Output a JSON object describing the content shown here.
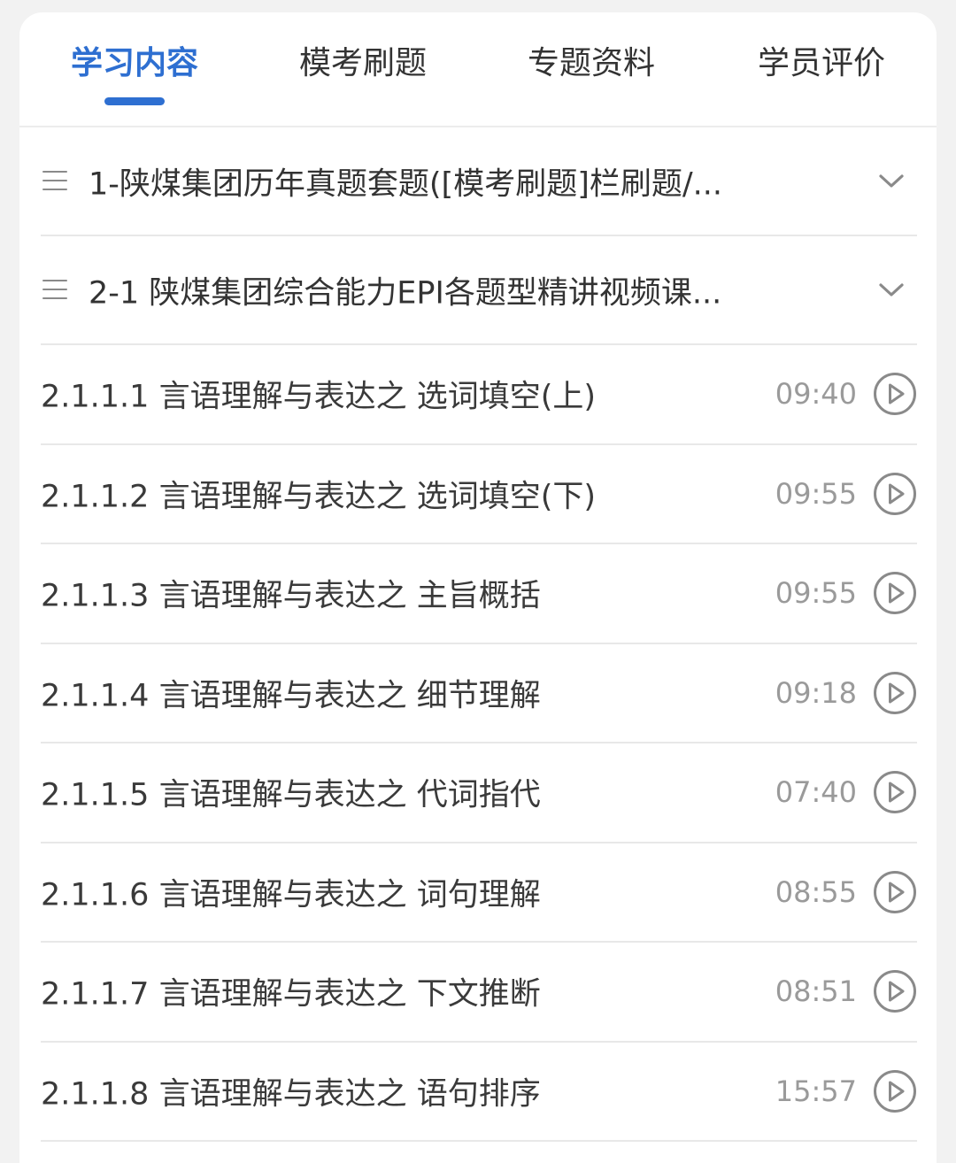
{
  "tabs": [
    {
      "label": "学习内容",
      "active": true
    },
    {
      "label": "模考刷题",
      "active": false
    },
    {
      "label": "专题资料",
      "active": false
    },
    {
      "label": "学员评价",
      "active": false
    }
  ],
  "colors": {
    "accent": "#2e6fd1",
    "text": "#333333",
    "muted": "#9a9a9a",
    "divider": "#e8e8e8"
  },
  "chapters": [
    {
      "title": "1-陕煤集团历年真题套题([模考刷题]栏刷题/...",
      "icon": "menu-icon",
      "toggle_icon": "chevron-down-icon"
    },
    {
      "title": "2-1 陕煤集团综合能力EPI各题型精讲视频课...",
      "icon": "menu-icon",
      "toggle_icon": "chevron-down-icon"
    }
  ],
  "lessons": [
    {
      "title": "2.1.1.1 言语理解与表达之 选词填空(上)",
      "duration": "09:40",
      "icon": "play-circle-icon"
    },
    {
      "title": "2.1.1.2 言语理解与表达之 选词填空(下)",
      "duration": "09:55",
      "icon": "play-circle-icon"
    },
    {
      "title": "2.1.1.3 言语理解与表达之 主旨概括",
      "duration": "09:55",
      "icon": "play-circle-icon"
    },
    {
      "title": "2.1.1.4 言语理解与表达之 细节理解",
      "duration": "09:18",
      "icon": "play-circle-icon"
    },
    {
      "title": "2.1.1.5 言语理解与表达之 代词指代",
      "duration": "07:40",
      "icon": "play-circle-icon"
    },
    {
      "title": "2.1.1.6 言语理解与表达之 词句理解",
      "duration": "08:55",
      "icon": "play-circle-icon"
    },
    {
      "title": "2.1.1.7 言语理解与表达之 下文推断",
      "duration": "08:51",
      "icon": "play-circle-icon"
    },
    {
      "title": "2.1.1.8 言语理解与表达之 语句排序",
      "duration": "15:57",
      "icon": "play-circle-icon"
    }
  ]
}
